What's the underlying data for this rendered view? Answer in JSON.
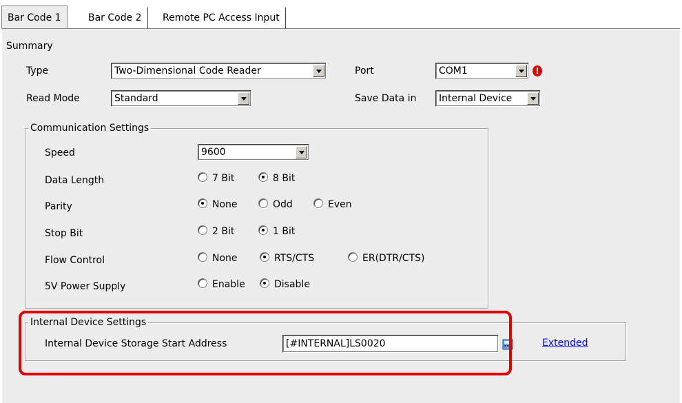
{
  "tabs": [
    {
      "label": "Bar Code 1",
      "active": true
    },
    {
      "label": "Bar Code 2",
      "active": false
    },
    {
      "label": "Remote PC Access Input",
      "active": false
    }
  ],
  "summary": {
    "title": "Summary",
    "type_label": "Type",
    "type_value": "Two-Dimensional Code Reader",
    "read_mode_label": "Read Mode",
    "read_mode_value": "Standard",
    "port_label": "Port",
    "port_value": "COM1",
    "port_alert": "!",
    "save_label": "Save Data in",
    "save_value": "Internal Device"
  },
  "comm": {
    "title": "Communication Settings",
    "speed_label": "Speed",
    "speed_value": "9600",
    "data_length_label": "Data Length",
    "data_length_options": [
      "7 Bit",
      "8 Bit"
    ],
    "data_length_selected": 1,
    "parity_label": "Parity",
    "parity_options": [
      "None",
      "Odd",
      "Even"
    ],
    "parity_selected": 0,
    "stop_bit_label": "Stop Bit",
    "stop_bit_options": [
      "2 Bit",
      "1 Bit"
    ],
    "stop_bit_selected": 1,
    "flow_label": "Flow Control",
    "flow_options": [
      "None",
      "RTS/CTS",
      "ER(DTR/CTS)"
    ],
    "flow_selected": 1,
    "power_label": "5V Power Supply",
    "power_options": [
      "Enable",
      "Disable"
    ],
    "power_selected": 1
  },
  "internal": {
    "title": "Internal Device Settings",
    "address_label": "Internal Device Storage Start Address",
    "address_value": "[#INTERNAL]LS0020",
    "extended_link": "Extended"
  },
  "colors": {
    "panel": "#ececec",
    "highlight": "#e00000",
    "link": "#0000ff"
  }
}
